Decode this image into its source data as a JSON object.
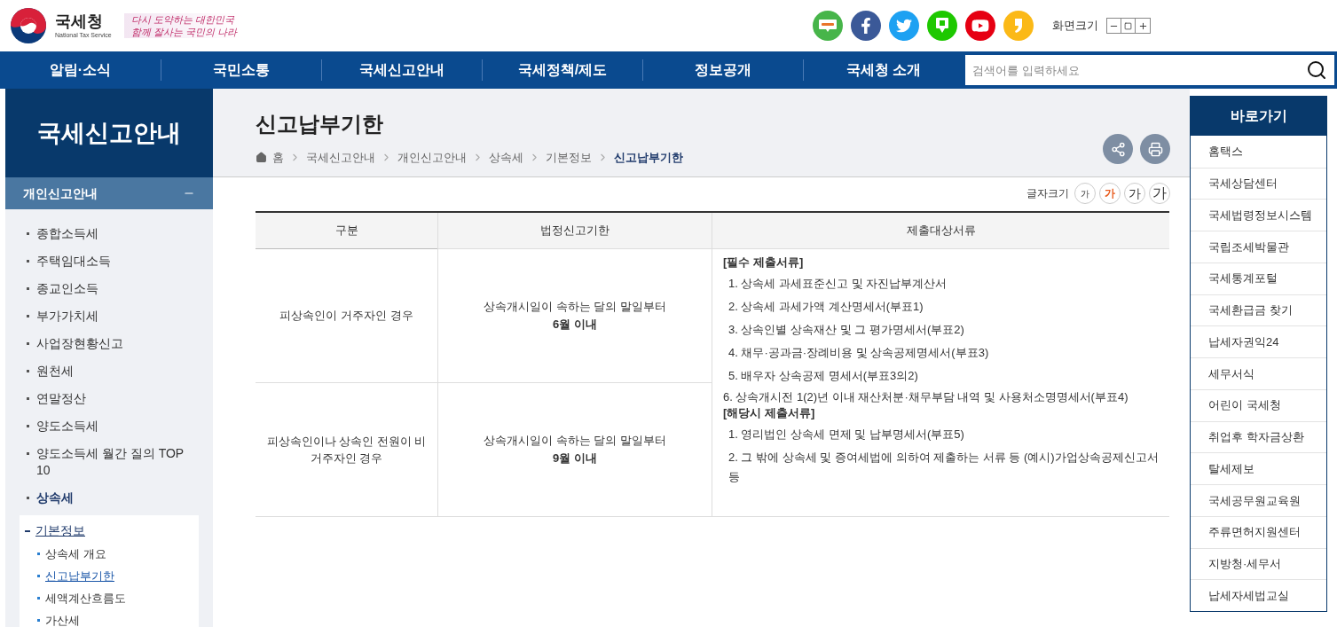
{
  "header": {
    "logo": {
      "name": "국세청",
      "subtitle": "National Tax Service"
    },
    "slogan": [
      "다시 도약하는 대한민국",
      "함께 잘사는 국민의 나라"
    ],
    "social_links": [
      {
        "kind": "blog"
      },
      {
        "kind": "facebook"
      },
      {
        "kind": "twitter"
      },
      {
        "kind": "band"
      },
      {
        "kind": "youtube"
      },
      {
        "kind": "story"
      }
    ],
    "screen_size": {
      "label": "화면크기"
    }
  },
  "nav": {
    "items": [
      "알림·소식",
      "국민소통",
      "국세신고안내",
      "국세정책/제도",
      "정보공개",
      "국세청 소개"
    ],
    "search": {
      "placeholder": "검색어를 입력하세요"
    }
  },
  "sidebar": {
    "title": "국세신고안내",
    "section": {
      "label": "개인신고안내",
      "expanded": true
    },
    "items": [
      {
        "label": "종합소득세",
        "selected": false
      },
      {
        "label": "주택임대소득",
        "selected": false
      },
      {
        "label": "종교인소득",
        "selected": false
      },
      {
        "label": "부가가치세",
        "selected": false
      },
      {
        "label": "사업장현황신고",
        "selected": false
      },
      {
        "label": "원천세",
        "selected": false
      },
      {
        "label": "연말정산",
        "selected": false
      },
      {
        "label": "양도소득세",
        "selected": false
      },
      {
        "label": "양도소득세 월간 질의 TOP 10",
        "selected": false
      },
      {
        "label": "상속세",
        "selected": true,
        "children": [
          {
            "label": "기본정보",
            "selected": true,
            "children": [
              {
                "label": "상속세 개요",
                "selected": false
              },
              {
                "label": "신고납부기한",
                "selected": true
              },
              {
                "label": "세액계산흐름도",
                "selected": false
              },
              {
                "label": "가산세",
                "selected": false
              }
            ]
          }
        ]
      }
    ]
  },
  "page": {
    "title": "신고납부기한",
    "breadcrumb": [
      "홈",
      "국세신고안내",
      "개인신고안내",
      "상속세",
      "기본정보",
      "신고납부기한"
    ]
  },
  "font_size": {
    "label": "글자크기",
    "options": [
      {
        "label": "가",
        "selected": false
      },
      {
        "label": "가",
        "selected": true
      },
      {
        "label": "가",
        "selected": false
      },
      {
        "label": "가",
        "selected": false
      }
    ]
  },
  "table": {
    "columns": [
      "구분",
      "법정신고기한",
      "제출대상서류"
    ],
    "rows": [
      {
        "case": "피상속인이 거주자인 경우",
        "deadline": {
          "text": "상속개시일이 속하는 달의 말일부터",
          "limit": "6월 이내"
        }
      },
      {
        "case": "피상속인이나 상속인 전원이 비거주자인 경우",
        "deadline": {
          "text": "상속개시일이 속하는 달의 말일부터",
          "limit": "9월 이내"
        }
      }
    ],
    "documents": [
      {
        "heading": "[필수 제출서류]",
        "items": [
          {
            "text": "1. 상속세 과세표준신고 및 자진납부계산서",
            "indented": true
          },
          {
            "text": "2. 상속세 과세가액 계산명세서(부표1)",
            "indented": true
          },
          {
            "text": "3. 상속인별 상속재산 및 그 평가명세서(부표2)",
            "indented": true
          },
          {
            "text": "4. 채무·공과금·장례비용 및 상속공제명세서(부표3)",
            "indented": true
          },
          {
            "text": "5. 배우자 상속공제 명세서(부표3의2)",
            "indented": true
          },
          {
            "text": "6. 상속개시전 1(2)년 이내 재산처분·채무부담 내역 및 사용처소명명세서(부표4)",
            "indented": false
          }
        ]
      },
      {
        "heading": "[해당시 제출서류]",
        "items": [
          {
            "text": "1. 영리법인 상속세 면제 및 납부명세서(부표5)",
            "indented": true
          },
          {
            "text": "2. 그 밖에 상속세 및 증여세법에 의하여 제출하는 서류 등 (예시)가업상속공제신고서 등",
            "indented": true
          }
        ]
      }
    ]
  },
  "quick_links": {
    "title": "바로가기",
    "items": [
      "홈택스",
      "국세상담센터",
      "국세법령정보시스템",
      "국립조세박물관",
      "국세통계포털",
      "국세환급금 찾기",
      "납세자권익24",
      "세무서식",
      "어린이 국세청",
      "취업후 학자금상환",
      "탈세제보",
      "국세공무원교육원",
      "주류면허지원센터",
      "지방청·세무서",
      "납세자세법교실"
    ]
  }
}
